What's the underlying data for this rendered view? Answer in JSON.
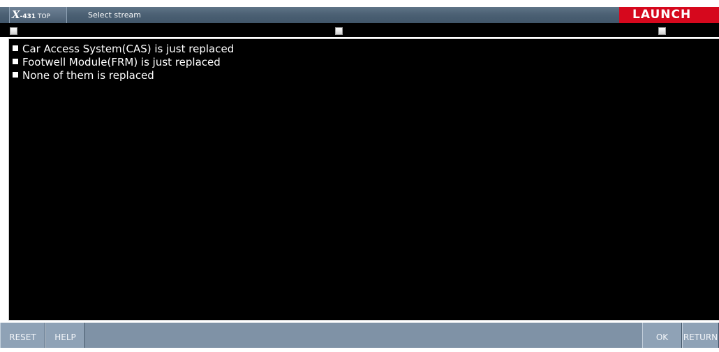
{
  "titlebar": {
    "brand": {
      "x": "X",
      "num": "-431",
      "top": " TOP"
    },
    "title": "Select stream",
    "logo": "LAUNCH"
  },
  "options": [
    "Car Access System(CAS) is just replaced",
    "Footwell Module(FRM) is just replaced",
    "None of them is replaced"
  ],
  "footer": {
    "reset": "RESET",
    "help": "HELP",
    "ok": "OK",
    "return": "RETURN"
  },
  "colors": {
    "titlebar": "#4c6174",
    "logo": "#d6081d",
    "background": "#000000",
    "footer": "#7f92a6"
  }
}
